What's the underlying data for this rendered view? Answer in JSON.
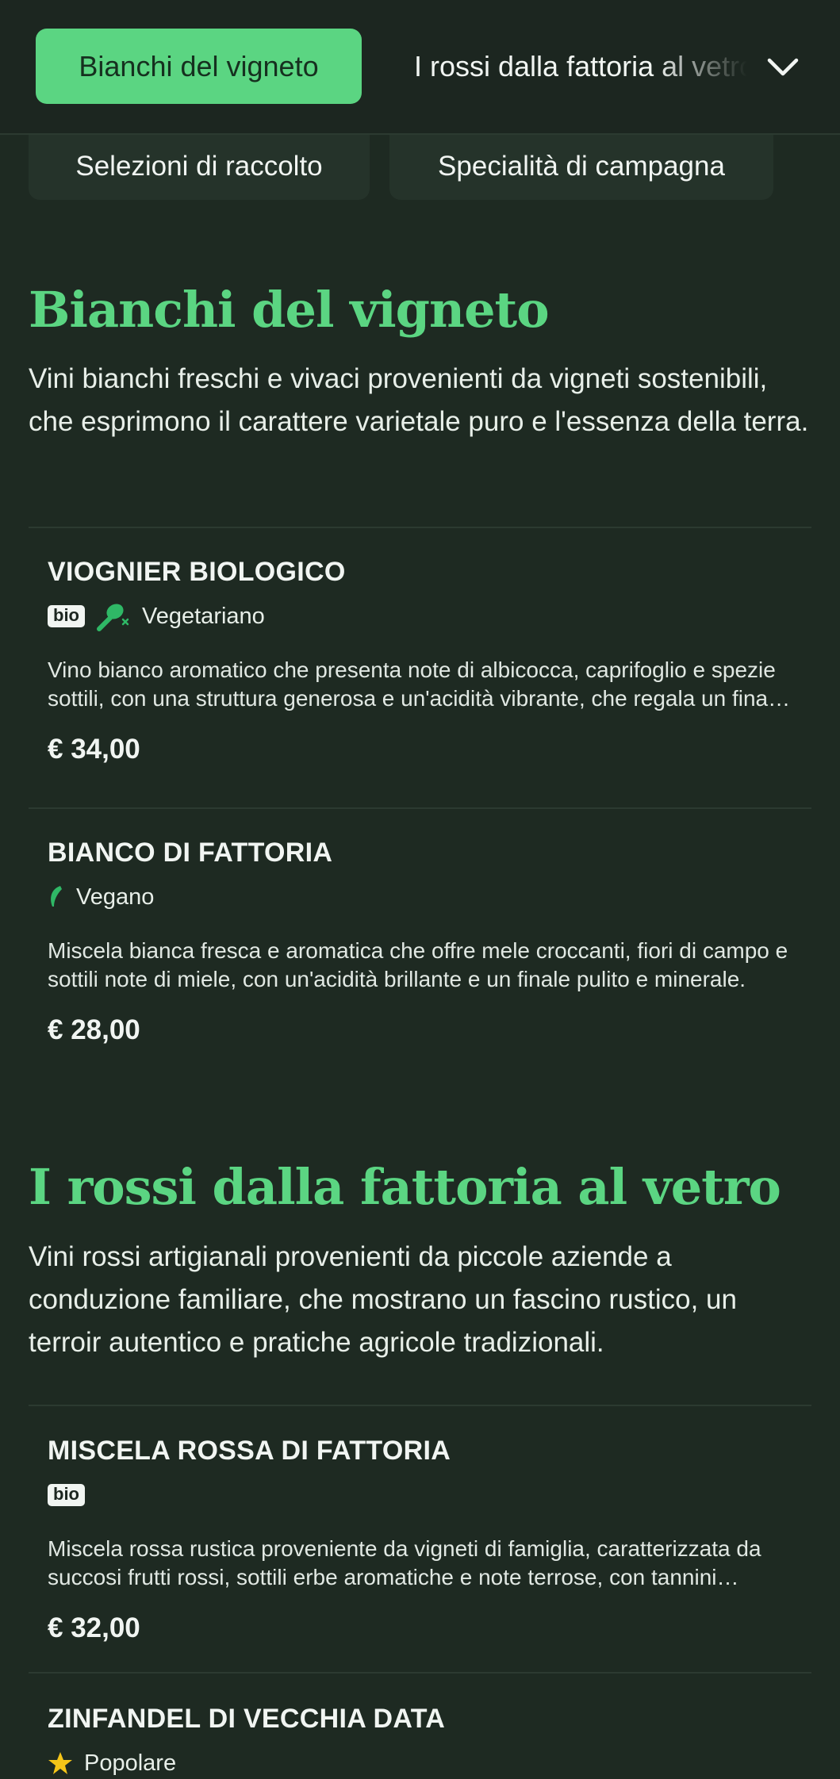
{
  "nav": {
    "active_category": "Bianchi del vigneto",
    "next_category": "I rossi dalla fattoria al vetro",
    "sub_categories": [
      "Selezioni di raccolto",
      "Specialità di campagna"
    ]
  },
  "sections": [
    {
      "title": "Bianchi del vigneto",
      "description": "Vini bianchi freschi e vivaci provenienti da vigneti sostenibili, che esprimono il carattere varietale puro e l'essenza della terra.",
      "items": [
        {
          "name": "VIOGNIER BIOLOGICO",
          "badge": "bio",
          "tag_label": "Vegetariano",
          "description": "Vino bianco aromatico che presenta note di albicocca, caprifoglio e spezie sottili, con una struttura generosa e un'acidità vibrante, che regala un finale lungo e morbido.",
          "price": "€ 34,00"
        },
        {
          "name": "BIANCO DI FATTORIA",
          "tag_label": "Vegano",
          "description": "Miscela bianca fresca e aromatica che offre mele croccanti, fiori di campo e sottili note di miele, con un'acidità brillante e un finale pulito e minerale.",
          "price": "€ 28,00"
        }
      ]
    },
    {
      "title": "I rossi dalla fattoria al vetro",
      "description": "Vini rossi artigianali provenienti da piccole aziende a conduzione familiare, che mostrano un fascino rustico, un terroir autentico e pratiche agricole tradizionali.",
      "items": [
        {
          "name": "MISCELA ROSSA DI FATTORIA",
          "badge": "bio",
          "description": "Miscela rossa rustica proveniente da vigneti di famiglia, caratterizzata da succosi frutti rossi, sottili erbe aromatiche e note terrose, con tannini morbidi.",
          "price": "€ 32,00"
        },
        {
          "name": "ZINFANDEL DI VECCHIA DATA",
          "tag_label": "Popolare"
        }
      ]
    }
  ],
  "colors": {
    "background": "#1e2a22",
    "accent_green": "#5bd582",
    "tag_green": "#2fb866",
    "star_yellow": "#f5c518"
  },
  "icons": [
    "chevron-down-icon",
    "vegetarian-icon",
    "vegan-leaf-icon",
    "star-icon"
  ]
}
